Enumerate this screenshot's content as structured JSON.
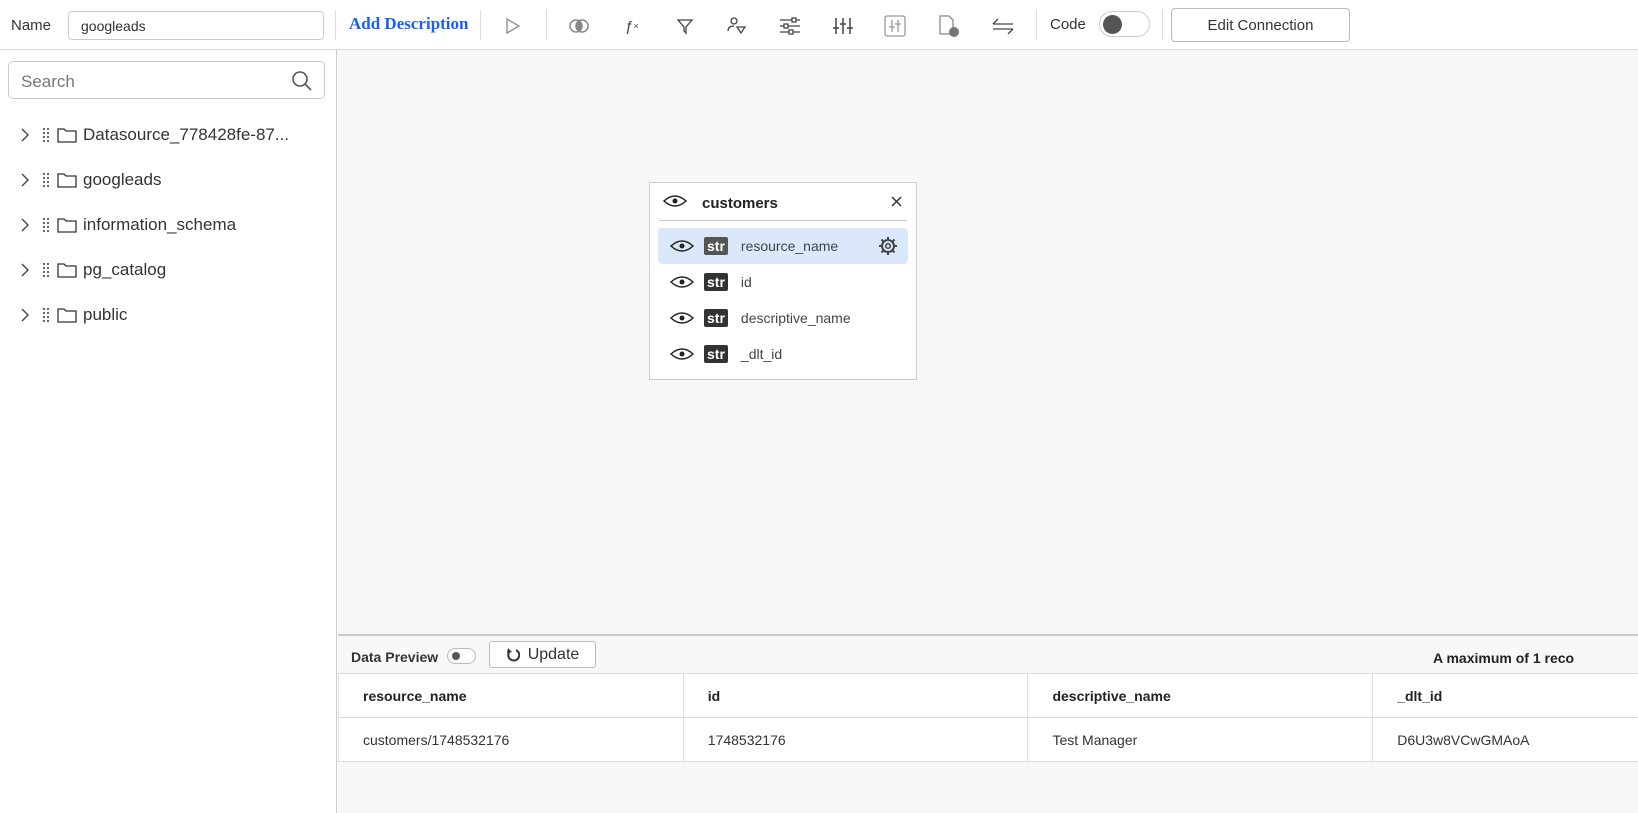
{
  "toolbar": {
    "name_label": "Name",
    "name_value": "googleads",
    "add_description": "Add Description",
    "code_label": "Code",
    "code_toggle_on": false,
    "edit_connection": "Edit Connection"
  },
  "sidebar": {
    "search_placeholder": "Search",
    "items": [
      {
        "label": "Datasource_778428fe-87..."
      },
      {
        "label": "googleads"
      },
      {
        "label": "information_schema"
      },
      {
        "label": "pg_catalog"
      },
      {
        "label": "public"
      }
    ]
  },
  "table_card": {
    "title": "customers",
    "type_badge": "str",
    "fields": [
      {
        "name": "resource_name",
        "type": "str",
        "selected": true
      },
      {
        "name": "id",
        "type": "str"
      },
      {
        "name": "descriptive_name",
        "type": "str"
      },
      {
        "name": "_dlt_id",
        "type": "str"
      }
    ]
  },
  "preview": {
    "label": "Data Preview",
    "update": "Update",
    "max_note": "A maximum of 1 reco",
    "columns": [
      "resource_name",
      "id",
      "descriptive_name",
      "_dlt_id"
    ],
    "rows": [
      [
        "customers/1748532176",
        "1748532176",
        "Test Manager",
        "D6U3w8VCwGMAoA"
      ]
    ]
  }
}
